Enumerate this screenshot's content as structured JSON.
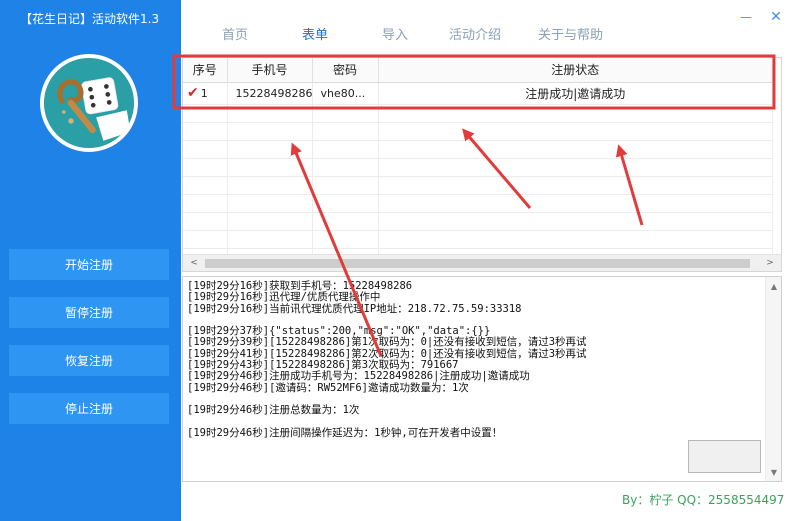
{
  "app": {
    "title": "【花生日记】活动软件1.3"
  },
  "logo": {
    "name": "peanut-diary-logo"
  },
  "sidebar": {
    "buttons": [
      {
        "label": "开始注册"
      },
      {
        "label": "暂停注册"
      },
      {
        "label": "恢复注册"
      },
      {
        "label": "停止注册"
      }
    ]
  },
  "nav": {
    "tabs": [
      {
        "label": "首页",
        "active": false
      },
      {
        "label": "表单",
        "active": true
      },
      {
        "label": "导入",
        "active": false
      },
      {
        "label": "活动介绍",
        "active": false
      },
      {
        "label": "关于与帮助",
        "active": false
      }
    ],
    "minimize_label": "—",
    "close_label": "✕"
  },
  "grid": {
    "columns": [
      "序号",
      "手机号",
      "密码",
      "注册状态"
    ],
    "rows": [
      {
        "index": "1",
        "phone": "15228498286",
        "password": "vhe80...",
        "status": "注册成功|邀请成功",
        "checked": true
      }
    ],
    "scroll_left": "<",
    "scroll_right": ">"
  },
  "log": {
    "lines": [
      "[19时29分16秒]获取到手机号：15228498286",
      "[19时29分16秒]迅代理/优质代理操作中",
      "[19时29分16秒]当前讯代理优质代理IP地址：218.72.75.59:33318",
      "",
      "[19时29分37秒]{\"status\":200,\"msg\":\"OK\",\"data\":{}}",
      "[19时29分39秒][15228498286]第1次取码为：0|还没有接收到短信，请过3秒再试",
      "[19时29分41秒][15228498286]第2次取码为：0|还没有接收到短信，请过3秒再试",
      "[19时29分43秒][15228498286]第3次取码为：791667",
      "[19时29分46秒]注册成功手机号为：15228498286|注册成功|邀请成功",
      "[19时29分46秒][邀请码：RW52MF6]邀请成功数量为：1次",
      "",
      "[19时29分46秒]注册总数量为：1次",
      "",
      "[19时29分46秒]注册间隔操作延迟为：1秒钟,可在开发者中设置！"
    ],
    "scroll_up": "▲",
    "scroll_down": "▼"
  },
  "footer": {
    "credit": "By：柠子   QQ：2558554497"
  },
  "colors": {
    "sidebar": "#1e82e6",
    "sidebar_button": "#2e95f2",
    "nav_active": "#1e6fd0",
    "nav_inactive": "#8aa0b8",
    "highlight": "#e23b3b",
    "footer": "#3aa35a"
  }
}
